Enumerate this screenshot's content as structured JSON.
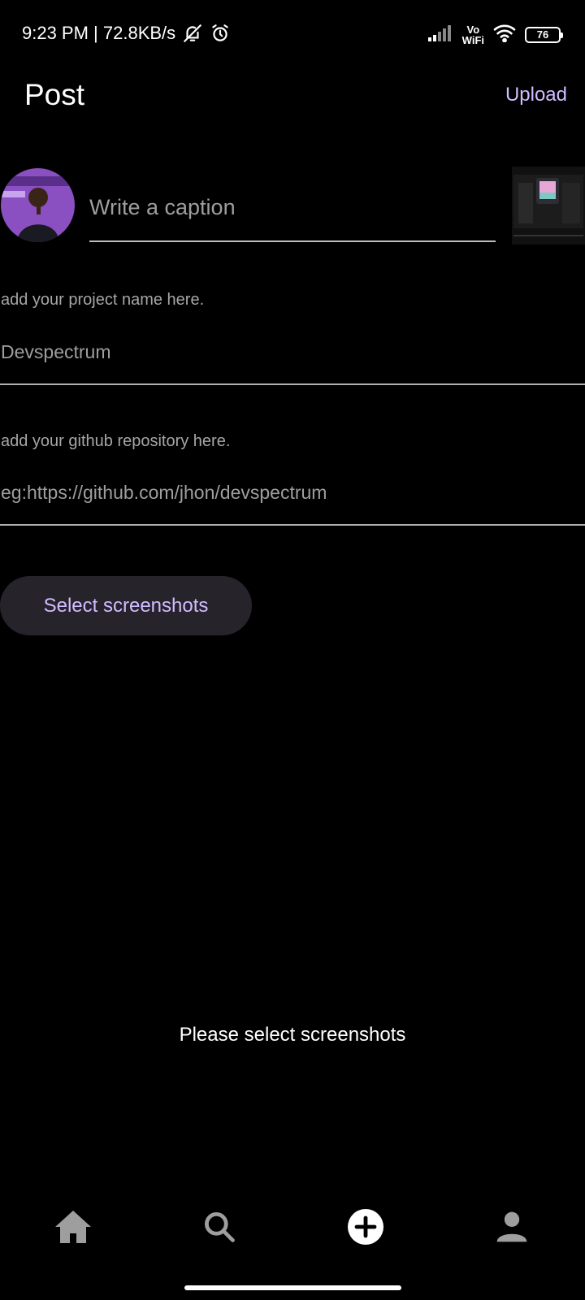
{
  "status_bar": {
    "time_speed": "9:23 PM | 72.8KB/s",
    "vowifi_top": "Vo",
    "vowifi_bottom": "WiFi",
    "battery": "76",
    "icons": [
      "mute-bell-icon",
      "alarm-icon",
      "signal-icon",
      "wifi-icon",
      "battery-icon"
    ]
  },
  "app_bar": {
    "title": "Post",
    "upload_label": "Upload"
  },
  "caption": {
    "placeholder": "Write a caption"
  },
  "project_field": {
    "hint": "add your project name here.",
    "value": "Devspectrum"
  },
  "github_field": {
    "hint": "add your github repository here.",
    "value": "eg:https://github.com/jhon/devspectrum"
  },
  "select_button_label": "Select screenshots",
  "empty_state": "Please select screenshots",
  "bottom_nav": {
    "items": [
      "home-icon",
      "search-icon",
      "add-post-icon",
      "profile-icon"
    ]
  },
  "colors": {
    "accent": "#d1bcff",
    "background": "#000000",
    "button_bg": "#26232b"
  }
}
